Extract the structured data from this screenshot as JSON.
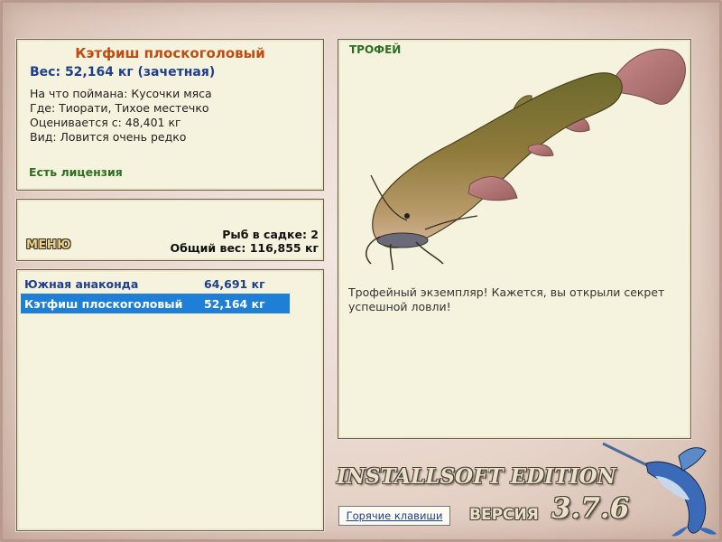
{
  "fish": {
    "name": "Кэтфиш плоскоголовый",
    "weight_line": "Вес: 52,164 кг (зачетная)",
    "bait_line": "На что поймана: Кусочки мяса",
    "place_line": "Где: Тиорати, Тихое местечко",
    "value_line": "Оценивается с: 48,401 кг",
    "kind_line": "Вид: Ловится очень редко",
    "license": "Есть лицензия"
  },
  "menu": {
    "button_label": "МЕНЮ",
    "cage_count": "Рыб в садке: 2",
    "total_weight": "Общий вес: 116,855 кг"
  },
  "catch_list": [
    {
      "name": "Южная анаконда",
      "weight": "64,691 кг",
      "selected": false
    },
    {
      "name": "Кэтфиш плоскоголовый",
      "weight": "52,164 кг",
      "selected": true
    }
  ],
  "trophy": {
    "label": "ТРОФЕЙ",
    "description": "Трофейный экземпляр! Кажется, вы открыли секрет успешной ловли!",
    "image_icon": "flathead-catfish-image"
  },
  "footer": {
    "edition": "INSTALLSOFT EDITION",
    "version_label": "ВЕРСИЯ",
    "version_number": "3.7.6",
    "hotkeys_label": "Горячие клавиши",
    "logo_icon": "marlin-icon"
  },
  "colors": {
    "panel_bg": "#f5f3dd",
    "title": "#c24b12",
    "weight": "#1f3e8c",
    "license": "#2c6e22",
    "selection": "#1f7fd6"
  }
}
